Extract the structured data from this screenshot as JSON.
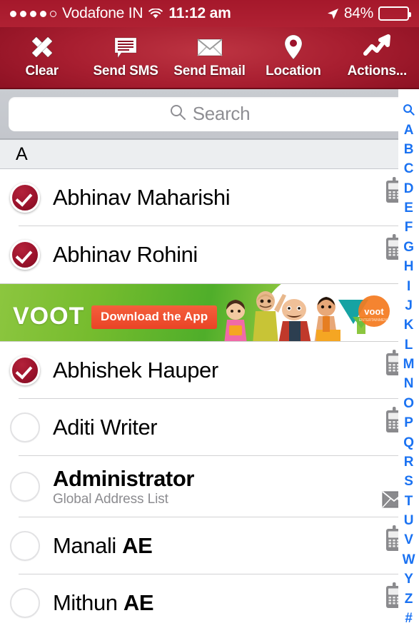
{
  "status_bar": {
    "signal_dots": [
      true,
      true,
      true,
      true,
      false
    ],
    "carrier": "Vodafone IN",
    "wifi_icon": "wifi-icon",
    "time": "11:12 am",
    "location_icon": "location-arrow-icon",
    "battery_percent": "84%",
    "battery_level": 84
  },
  "toolbar": {
    "items": [
      {
        "label": "Clear",
        "icon": "close-x-icon"
      },
      {
        "label": "Send SMS",
        "icon": "speech-bubble-icon"
      },
      {
        "label": "Send Email",
        "icon": "envelope-icon"
      },
      {
        "label": "Location",
        "icon": "map-pin-icon"
      },
      {
        "label": "Actions...",
        "icon": "trending-up-arrow-icon"
      }
    ],
    "background_color": "#a81e30",
    "background_edge_color": "#7e0d1d"
  },
  "search": {
    "placeholder": "Search",
    "value": "",
    "icon": "search-icon"
  },
  "section_header": {
    "label": "A"
  },
  "contacts": [
    {
      "name": "Abhinav Maharishi",
      "bold_suffix": "",
      "subtitle": "",
      "selected": true,
      "type_icon": "mobile-phone-icon"
    },
    {
      "name": "Abhinav Rohini",
      "bold_suffix": "",
      "subtitle": "",
      "selected": true,
      "type_icon": "mobile-phone-icon"
    },
    {
      "name": "Abhishek Hauper",
      "bold_suffix": "",
      "subtitle": "",
      "selected": true,
      "type_icon": "mobile-phone-icon"
    },
    {
      "name": "Aditi Writer",
      "bold_suffix": "",
      "subtitle": "",
      "selected": false,
      "type_icon": "mobile-phone-icon"
    },
    {
      "name": "Administrator",
      "bold_suffix": "",
      "all_bold": true,
      "subtitle": "Global Address List",
      "selected": false,
      "type_icon": "envelope-icon"
    },
    {
      "name": "Manali ",
      "bold_suffix": "AE",
      "subtitle": "",
      "selected": false,
      "type_icon": "mobile-phone-icon"
    },
    {
      "name": "Mithun ",
      "bold_suffix": "AE",
      "subtitle": "",
      "selected": false,
      "type_icon": "mobile-phone-icon"
    }
  ],
  "ad": {
    "brand": "VOOT",
    "cta": "Download the App",
    "logo_text": "voot",
    "background_start": "#8cc63f",
    "background_end": "#ffffff",
    "cta_color": "#ea4326"
  },
  "index_bar": {
    "accent_color": "#1a72f2",
    "entries": [
      "search-icon",
      "A",
      "B",
      "C",
      "D",
      "E",
      "F",
      "G",
      "H",
      "I",
      "J",
      "K",
      "L",
      "M",
      "N",
      "O",
      "P",
      "Q",
      "R",
      "S",
      "T",
      "U",
      "V",
      "W",
      "Y",
      "Z",
      "#"
    ]
  },
  "colors": {
    "accent_red": "#a81e30",
    "checked_red": "#9c132c",
    "index_blue": "#1a72f2",
    "subtitle_grey": "#8c8c90"
  }
}
